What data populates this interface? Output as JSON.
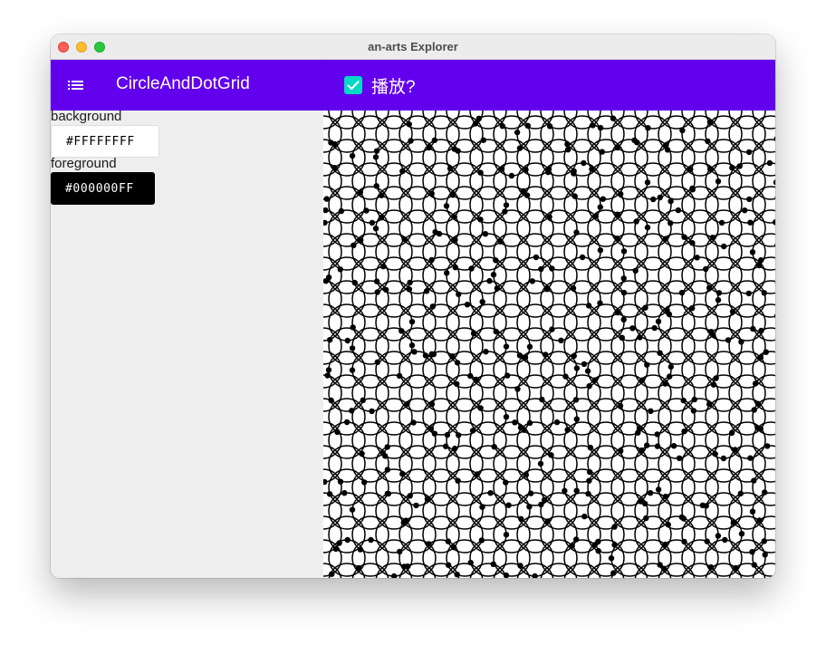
{
  "window": {
    "title": "an-arts Explorer"
  },
  "appbar": {
    "menu_icon": "menu-list-icon",
    "title": "CircleAndDotGrid",
    "play": {
      "label": "播放?",
      "checked": true
    }
  },
  "params": {
    "background": {
      "label": "background",
      "value": "#FFFFFFFF"
    },
    "foreground": {
      "label": "foreground",
      "value": "#000000FF"
    }
  },
  "colors": {
    "accent": "#6200ee",
    "checkbox": "#03dac6",
    "art_background": "#FFFFFF",
    "art_foreground": "#000000"
  }
}
